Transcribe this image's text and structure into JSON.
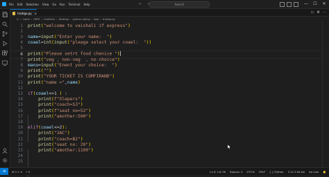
{
  "menu": [
    "File",
    "Edit",
    "Selection",
    "View",
    "Go",
    "Run",
    "Terminal",
    "Help"
  ],
  "nav": "← →",
  "search": {
    "placeholder": "Search"
  },
  "window": {
    "minimize": "—",
    "maximize": "☐",
    "close": "✕"
  },
  "tab": {
    "label": "trailrgo.py",
    "close": "×"
  },
  "editor_actions": [
    "▷",
    "⚙",
    "⋯"
  ],
  "breadcrumb": [
    "C:",
    "Users",
    "HRYS",
    "OneDrive",
    "Desktop",
    "python coding",
    "loop",
    "trailrgo.py"
  ],
  "lines": [
    {
      "n": "1",
      "t": [
        [
          "fn",
          "print"
        ],
        [
          "par",
          "("
        ],
        [
          "str",
          "\"welcome to vaishali if express\""
        ],
        [
          "par",
          ")"
        ]
      ]
    },
    {
      "n": "2",
      "t": []
    },
    {
      "n": "3",
      "t": [
        [
          "var",
          "name"
        ],
        [
          "pl",
          "="
        ],
        [
          "fn",
          "input"
        ],
        [
          "par",
          "("
        ],
        [
          "str",
          "\"Enter your name:  \""
        ],
        [
          "par",
          ")"
        ]
      ]
    },
    {
      "n": "4",
      "t": [
        [
          "var",
          "coael"
        ],
        [
          "pl",
          "="
        ],
        [
          "fn",
          "int"
        ],
        [
          "par",
          "("
        ],
        [
          "fn",
          "input"
        ],
        [
          "par",
          "("
        ],
        [
          "str",
          "\"pleage select your coael:  \""
        ],
        [
          "par",
          "))"
        ]
      ]
    },
    {
      "n": "5",
      "t": []
    },
    {
      "n": "6",
      "t": [
        [
          "fn",
          "print"
        ],
        [
          "par",
          "("
        ],
        [
          "str",
          "\"Please setrt food chenice \""
        ],
        [
          "par",
          ")"
        ]
      ]
    },
    {
      "n": "7",
      "t": [
        [
          "fn",
          "print"
        ],
        [
          "par",
          "("
        ],
        [
          "str",
          "\"veg , non-veg  , no-choice\""
        ],
        [
          "par",
          ")"
        ]
      ]
    },
    {
      "n": "8",
      "t": [
        [
          "var",
          "manu"
        ],
        [
          "pl",
          "="
        ],
        [
          "fn",
          "input"
        ],
        [
          "par",
          "("
        ],
        [
          "str",
          "\"Enent your choice:  \""
        ],
        [
          "par",
          ")"
        ]
      ]
    },
    {
      "n": "9",
      "t": [
        [
          "fn",
          "print"
        ],
        [
          "par",
          "("
        ],
        [
          "str",
          "\"\""
        ],
        [
          "par",
          ")"
        ]
      ]
    },
    {
      "n": "10",
      "t": [
        [
          "fn",
          "print"
        ],
        [
          "par",
          "("
        ],
        [
          "str",
          "\"YOUR TICKET IS COMFIRAND\""
        ],
        [
          "par",
          ")"
        ]
      ]
    },
    {
      "n": "11",
      "t": [
        [
          "fn",
          "print"
        ],
        [
          "par",
          "("
        ],
        [
          "str",
          "\"name =\""
        ],
        [
          "pl",
          ","
        ],
        [
          "var",
          "name"
        ],
        [
          "par",
          ")"
        ]
      ]
    },
    {
      "n": "12",
      "t": []
    },
    {
      "n": "13",
      "t": [
        [
          "kw",
          "if"
        ],
        [
          "par",
          "("
        ],
        [
          "var",
          "coael"
        ],
        [
          "pl",
          "<=1 "
        ],
        [
          "par",
          ")"
        ],
        [
          "pl",
          " :"
        ]
      ]
    },
    {
      "n": "14",
      "t": [
        [
          "pl",
          "    "
        ],
        [
          "fn",
          "print"
        ],
        [
          "par",
          "("
        ],
        [
          "str",
          "f\"Slepers\""
        ],
        [
          "par",
          ")"
        ]
      ]
    },
    {
      "n": "15",
      "t": [
        [
          "pl",
          "    "
        ],
        [
          "fn",
          "print"
        ],
        [
          "par",
          "("
        ],
        [
          "str",
          "\"coach=S3\""
        ],
        [
          "par",
          ")"
        ]
      ]
    },
    {
      "n": "16",
      "t": [
        [
          "pl",
          "    "
        ],
        [
          "fn",
          "print"
        ],
        [
          "par",
          "("
        ],
        [
          "str",
          "f\"seat no=52\""
        ],
        [
          "par",
          ")"
        ]
      ]
    },
    {
      "n": "17",
      "t": [
        [
          "pl",
          "    "
        ],
        [
          "fn",
          "print"
        ],
        [
          "par",
          "("
        ],
        [
          "str",
          "\"amother:500\""
        ],
        [
          "par",
          ")"
        ]
      ]
    },
    {
      "n": "18",
      "t": []
    },
    {
      "n": "19",
      "t": [
        [
          "kw",
          "elif"
        ],
        [
          "par",
          "("
        ],
        [
          "var",
          "coael"
        ],
        [
          "pl",
          "<=2"
        ],
        [
          "par",
          "):"
        ]
      ]
    },
    {
      "n": "20",
      "t": [
        [
          "pl",
          "    "
        ],
        [
          "fn",
          "print"
        ],
        [
          "par",
          "("
        ],
        [
          "str",
          "\"3AC\""
        ],
        [
          "par",
          ")"
        ]
      ]
    },
    {
      "n": "21",
      "t": [
        [
          "pl",
          "    "
        ],
        [
          "fn",
          "print"
        ],
        [
          "par",
          "("
        ],
        [
          "str",
          "\"coach=B2\""
        ],
        [
          "par",
          ")"
        ]
      ]
    },
    {
      "n": "22",
      "t": [
        [
          "pl",
          "    "
        ],
        [
          "fn",
          "print"
        ],
        [
          "par",
          "("
        ],
        [
          "str",
          "\"seat no: 20\""
        ],
        [
          "par",
          ")"
        ]
      ]
    },
    {
      "n": "23",
      "t": [
        [
          "pl",
          "    "
        ],
        [
          "fn",
          "print"
        ],
        [
          "par",
          "("
        ],
        [
          "str",
          "\"amother:1100\""
        ],
        [
          "par",
          ")"
        ]
      ]
    },
    {
      "n": "24",
      "t": []
    },
    {
      "n": "25",
      "t": []
    }
  ],
  "current_line": 6,
  "status": {
    "remote": "⋊",
    "left": [
      "⊗ 0 ⚠ 0",
      "⚡ 0"
    ],
    "right": [
      "Ln 6, Col 36",
      "Spaces: 4",
      "UTF-8",
      "CRLF",
      "{ } Python",
      "3.12.3 64-bit",
      "Go Live",
      "🔔"
    ]
  },
  "colors": {
    "accent": "#0078d4",
    "string": "#ce9178",
    "function": "#dcdcaa",
    "variable": "#9cdcfe",
    "keyword": "#c586c0"
  }
}
